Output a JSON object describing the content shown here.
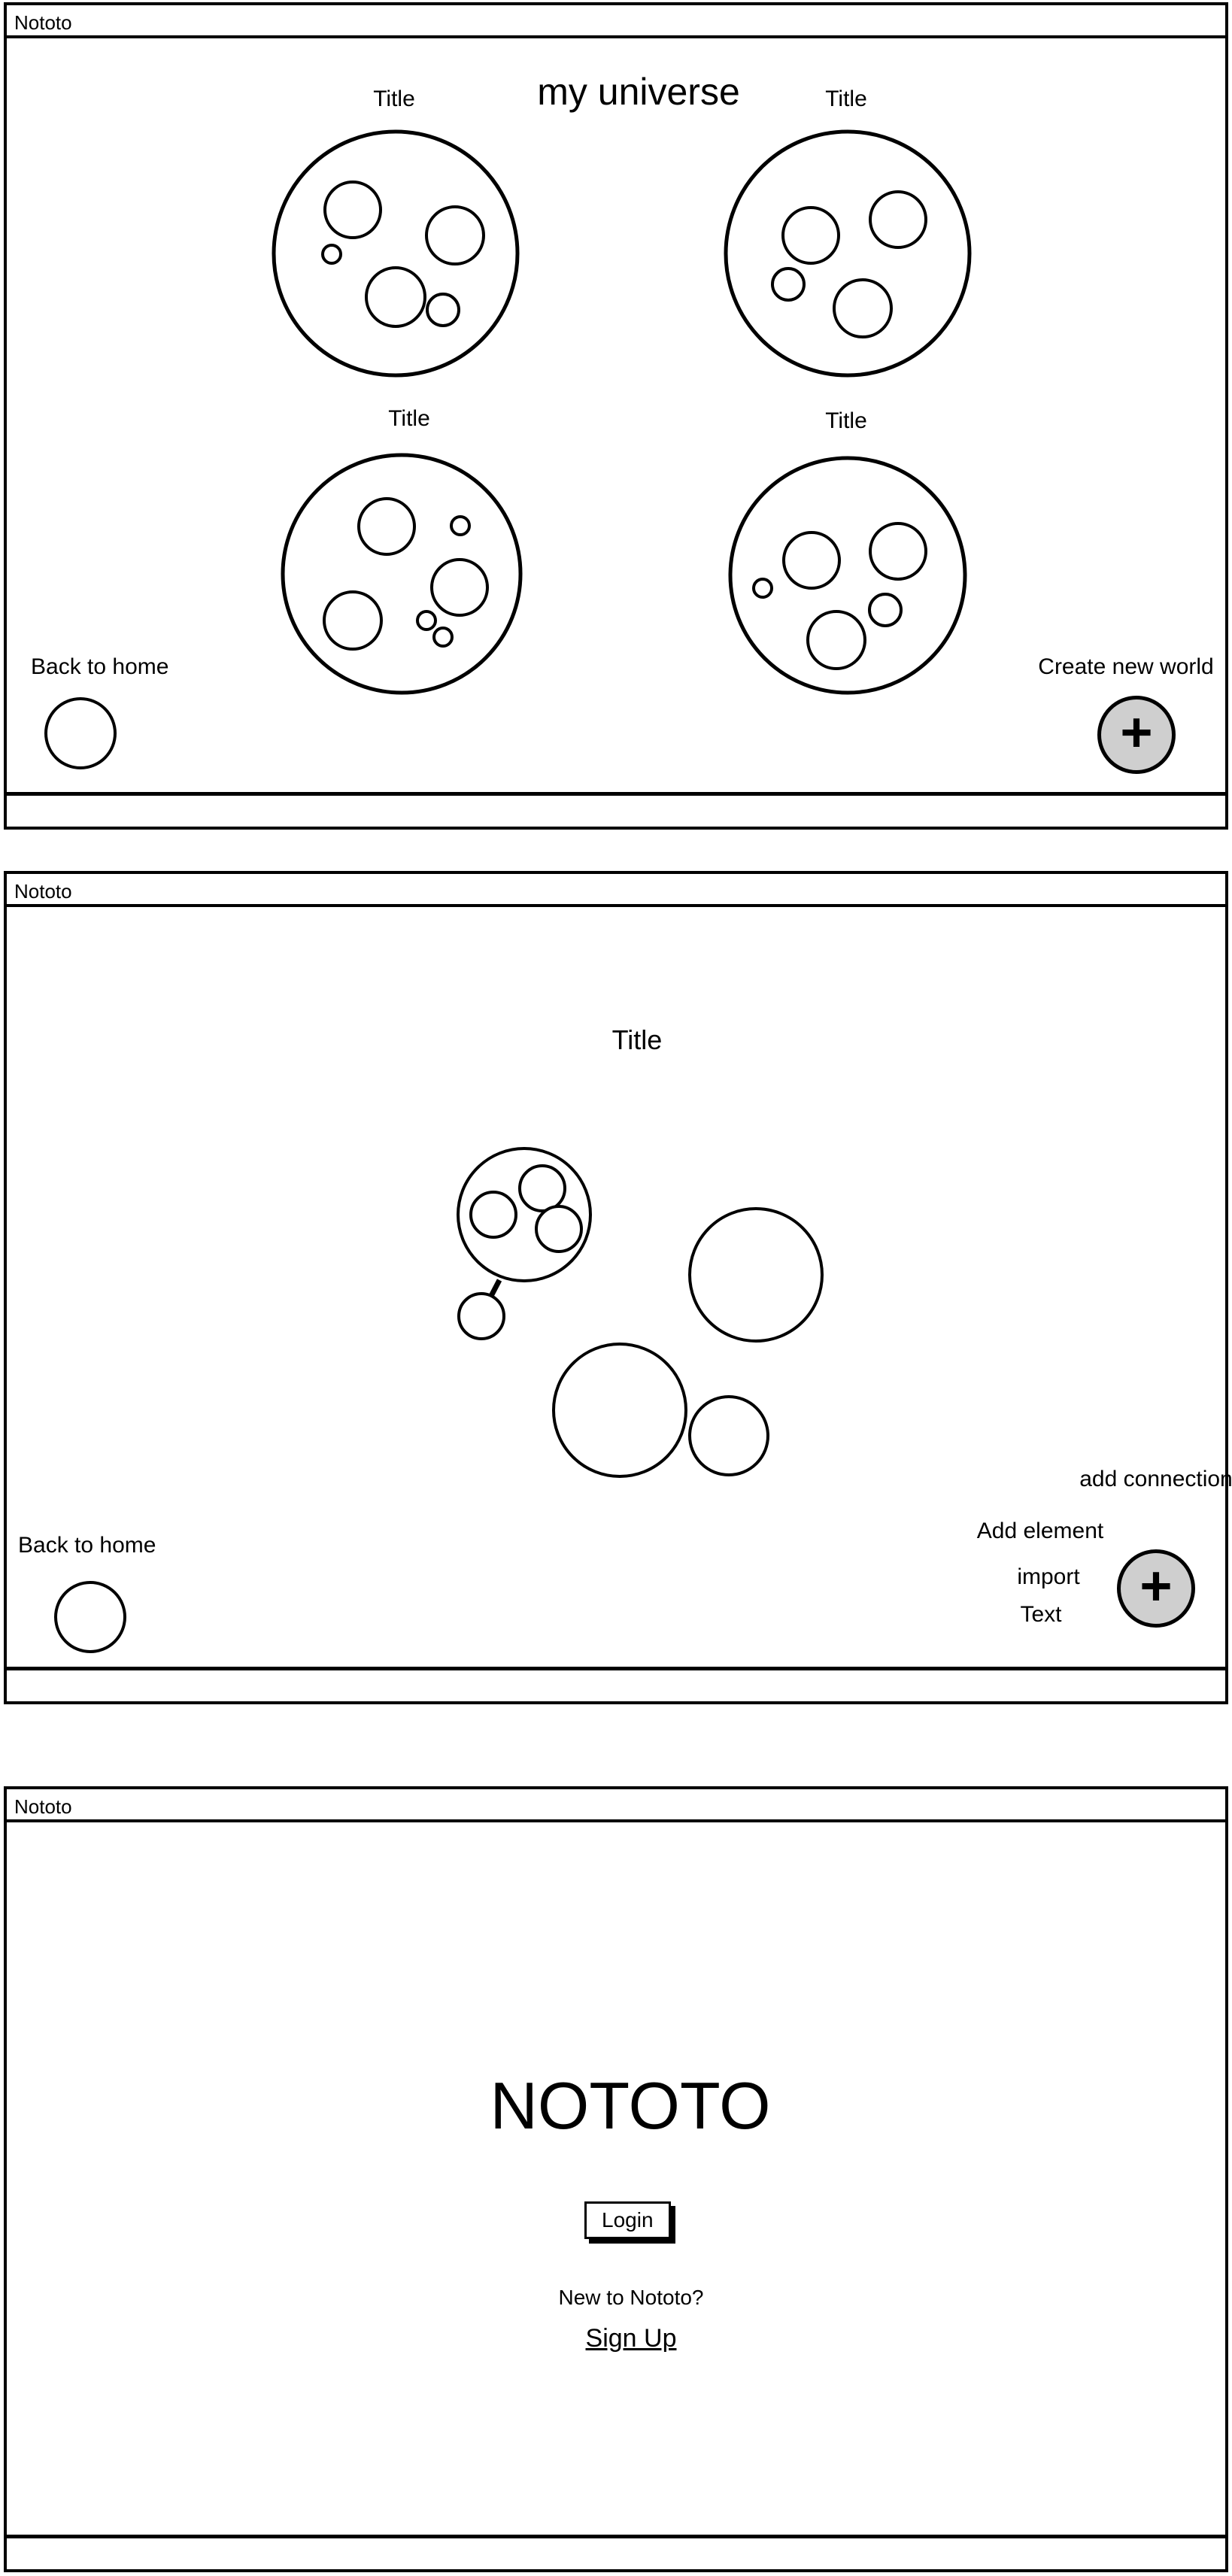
{
  "app_name": "Nototo",
  "universe_screen": {
    "heading": "my universe",
    "worlds": [
      {
        "title": "Title"
      },
      {
        "title": "Title"
      },
      {
        "title": "Title"
      },
      {
        "title": "Title"
      }
    ],
    "back_label": "Back to home",
    "create_label": "Create new world",
    "create_icon": "plus-icon"
  },
  "world_screen": {
    "title": "Title",
    "back_label": "Back to home",
    "fab_menu": {
      "add_connection": "add connection",
      "add_element": "Add element",
      "import": "import",
      "text": "Text"
    },
    "fab_icon": "plus-icon"
  },
  "home_screen": {
    "logo_text": "NOTOTO",
    "login_label": "Login",
    "new_prompt": "New to Nototo?",
    "signup_label": "Sign Up"
  }
}
